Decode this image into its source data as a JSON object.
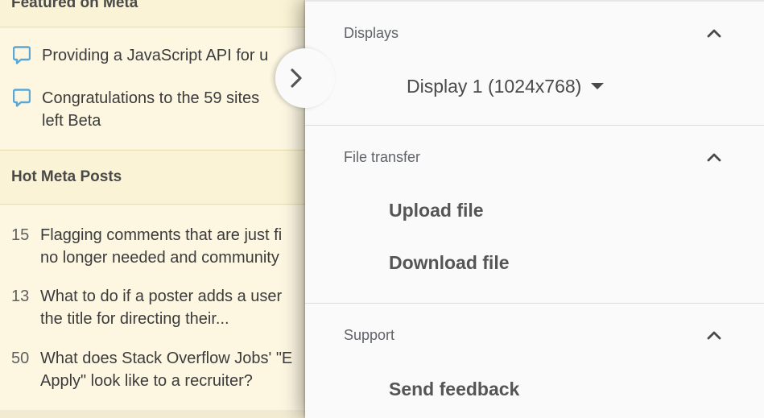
{
  "background_page": {
    "featured_heading": "Featured on Meta",
    "featured_items": [
      {
        "text": "Providing a JavaScript API for u"
      },
      {
        "text": "Congratulations to the 59 sites\nleft Beta"
      }
    ],
    "hot_heading": "Hot Meta Posts",
    "hot_items": [
      {
        "count": "15",
        "text": "Flagging comments that are just fi\nno longer needed and community"
      },
      {
        "count": "13",
        "text": "What to do if a poster adds a user\nthe title for directing their..."
      },
      {
        "count": "50",
        "text": "What does Stack Overflow Jobs' \"E\nApply\" look like to a recruiter?"
      }
    ]
  },
  "side_panel": {
    "displays": {
      "title": "Displays",
      "selected_display": "Display 1 (1024x768)"
    },
    "file_transfer": {
      "title": "File transfer",
      "upload_label": "Upload file",
      "download_label": "Download file"
    },
    "support": {
      "title": "Support",
      "feedback_label": "Send feedback"
    }
  },
  "icons": {
    "handle": "chevron-right-icon",
    "collapse": "chevron-up-icon",
    "dropdown": "caret-down-icon",
    "meta": "speech-bubble-icon"
  },
  "colors": {
    "meta_icon": "#5aa7d6",
    "panel_bg": "#fafafa",
    "sidebar_bg": "#fbf3d5"
  }
}
